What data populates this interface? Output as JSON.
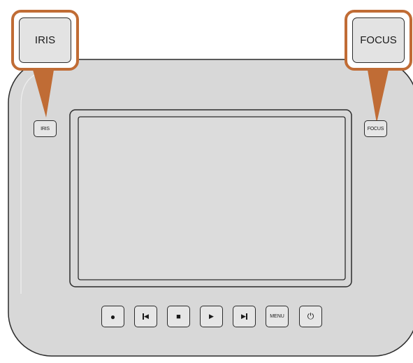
{
  "side_buttons": {
    "iris_label": "IRIS",
    "focus_label": "FOCUS"
  },
  "callouts": {
    "iris_label": "IRIS",
    "focus_label": "FOCUS"
  },
  "controls": {
    "record_icon": "●",
    "skip_back_icon": "◀",
    "stop_icon": "■",
    "play_icon": "▶",
    "skip_forward_icon": "▶",
    "menu_label": "MENU",
    "power_icon": "⏻"
  },
  "colors": {
    "callout_accent": "#c06c35",
    "device_body": "#d8d8d8",
    "outline": "#2b2b2b"
  }
}
